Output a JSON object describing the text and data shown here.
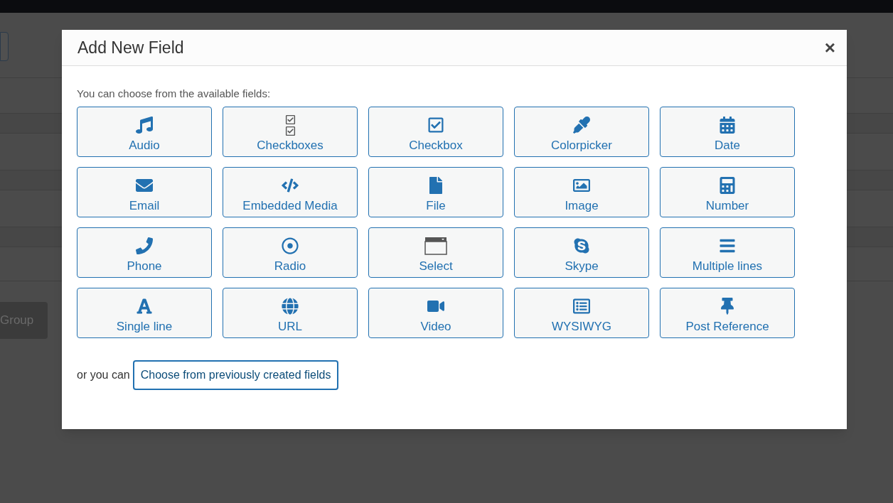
{
  "background": {
    "group_button": "Group"
  },
  "dialog": {
    "title": "Add New Field",
    "close": "×",
    "intro": "You can choose from the available fields:",
    "fields": [
      {
        "kind": "audio",
        "label": "Audio"
      },
      {
        "kind": "checkboxes",
        "label": "Checkboxes"
      },
      {
        "kind": "checkbox",
        "label": "Checkbox"
      },
      {
        "kind": "colorpicker",
        "label": "Colorpicker"
      },
      {
        "kind": "date",
        "label": "Date"
      },
      {
        "kind": "email",
        "label": "Email"
      },
      {
        "kind": "embed",
        "label": "Embedded Media"
      },
      {
        "kind": "file",
        "label": "File"
      },
      {
        "kind": "image",
        "label": "Image"
      },
      {
        "kind": "number",
        "label": "Number"
      },
      {
        "kind": "phone",
        "label": "Phone"
      },
      {
        "kind": "radio",
        "label": "Radio"
      },
      {
        "kind": "select",
        "label": "Select"
      },
      {
        "kind": "skype",
        "label": "Skype"
      },
      {
        "kind": "lines",
        "label": "Multiple lines"
      },
      {
        "kind": "text",
        "label": "Single line"
      },
      {
        "kind": "url",
        "label": "URL"
      },
      {
        "kind": "video",
        "label": "Video"
      },
      {
        "kind": "wysiwyg",
        "label": "WYSIWYG"
      },
      {
        "kind": "post",
        "label": "Post Reference"
      }
    ],
    "footer_text": "or you can",
    "footer_button": "Choose from previously created fields"
  }
}
